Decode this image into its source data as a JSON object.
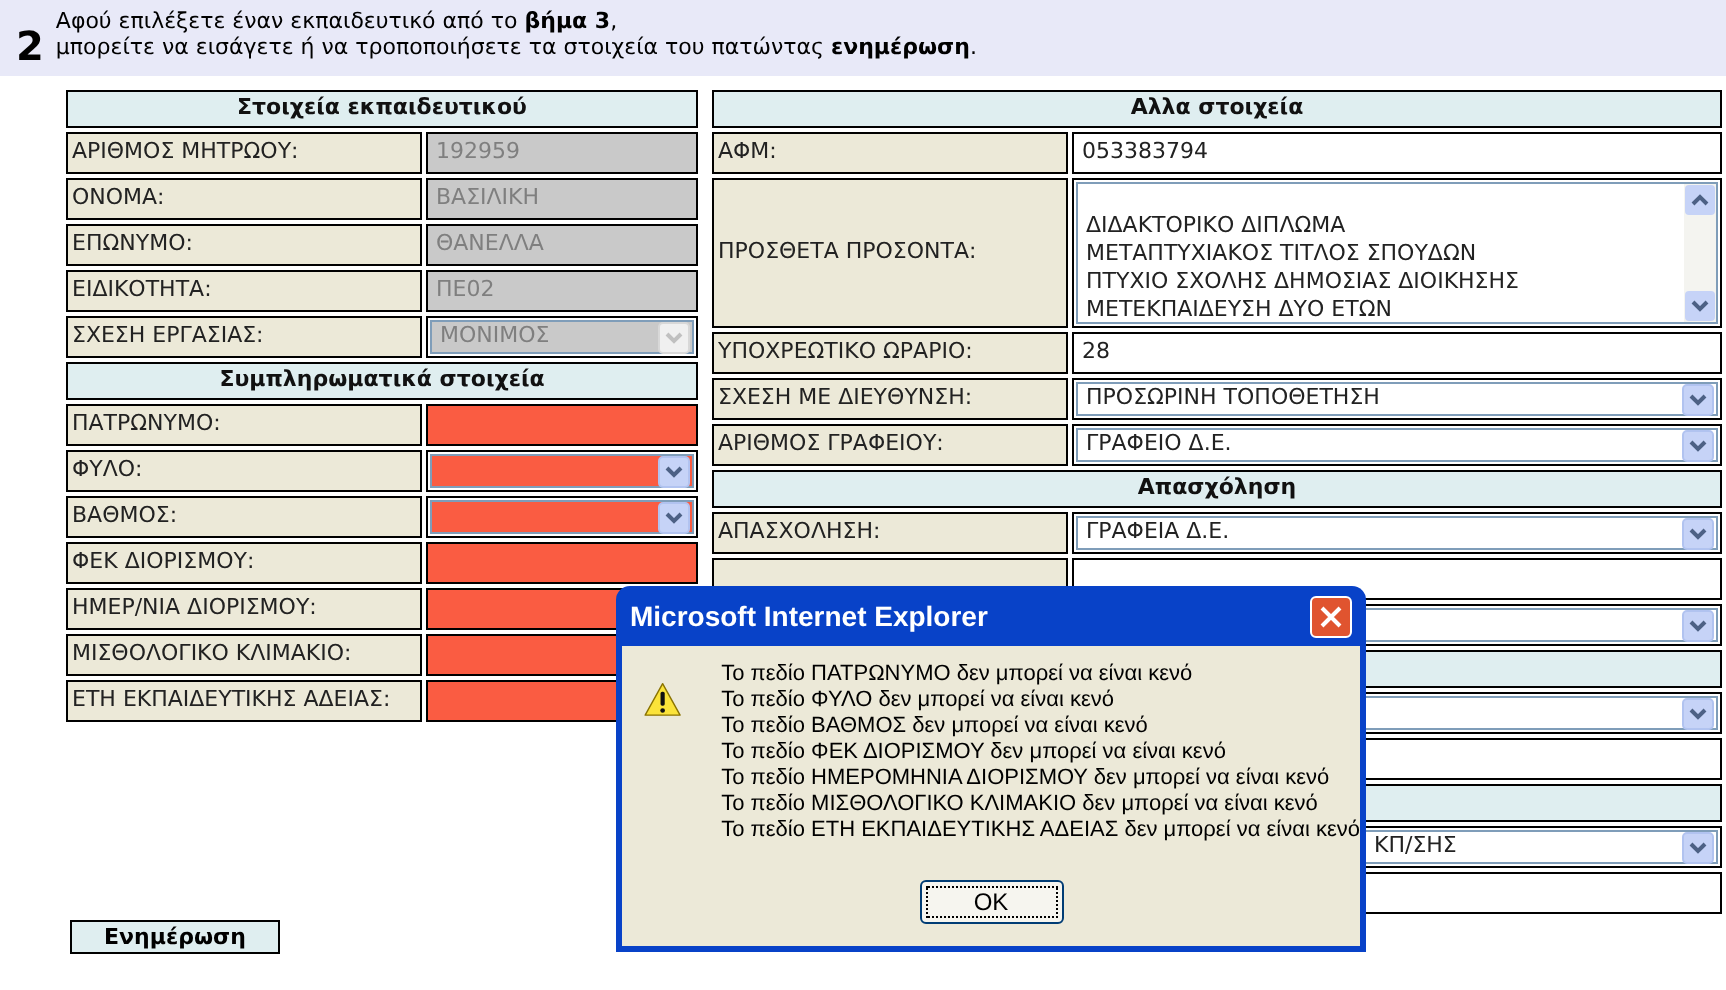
{
  "intro": {
    "step": "2",
    "lines": [
      "Αφού επιλέξετε έναν εκπαιδευτικό από το **βήμα 3**,",
      "μπορείτε να εισάγετε ή να τροποποιήσετε τα στοιχεία του πατώντας **ενημέρωση**."
    ]
  },
  "left_panel": [
    {
      "kind": "header",
      "title": "Στοιχεία εκπαιδευτικού"
    },
    {
      "kind": "input",
      "label": "ΑΡΙΘΜΟΣ ΜΗΤΡΩΟΥ:",
      "value": "192959",
      "disabled": true,
      "invalid": false
    },
    {
      "kind": "input",
      "label": "ΟΝΟΜΑ:",
      "value": "ΒΑΣΙΛΙΚΗ",
      "disabled": true,
      "invalid": false
    },
    {
      "kind": "input",
      "label": "ΕΠΩΝΥΜΟ:",
      "value": "ΘΑΝΕΛΛΑ",
      "disabled": true,
      "invalid": false
    },
    {
      "kind": "input",
      "label": "ΕΙΔΙΚΟΤΗΤΑ:",
      "value": "ΠΕ02",
      "disabled": true,
      "invalid": false
    },
    {
      "kind": "select",
      "label": "ΣΧΕΣΗ ΕΡΓΑΣΙΑΣ:",
      "value": "ΜΟΝΙΜΟΣ",
      "disabled": true,
      "invalid": false
    },
    {
      "kind": "header",
      "title": "Συμπληρωματικά στοιχεία"
    },
    {
      "kind": "input",
      "label": "ΠΑΤΡΩΝΥΜΟ:",
      "disabled": false,
      "invalid": true
    },
    {
      "kind": "select",
      "label": "ΦΥΛΟ:",
      "disabled": false,
      "invalid": true
    },
    {
      "kind": "select",
      "label": "ΒΑΘΜΟΣ:",
      "disabled": false,
      "invalid": true
    },
    {
      "kind": "input",
      "label": "ΦΕΚ ΔΙΟΡΙΣΜΟΥ:",
      "disabled": false,
      "invalid": true
    },
    {
      "kind": "input",
      "label": "ΗΜΕΡ/ΝΙΑ ΔΙΟΡΙΣΜΟΥ:",
      "disabled": false,
      "invalid": true
    },
    {
      "kind": "input",
      "label": "ΜΙΣΘΟΛΟΓΙΚΟ ΚΛΙΜΑΚΙΟ:",
      "disabled": false,
      "invalid": true
    },
    {
      "kind": "input",
      "label": "ΕΤΗ ΕΚΠΑΙΔΕΥΤΙΚΗΣ ΑΔΕΙΑΣ:",
      "disabled": false,
      "invalid": true
    }
  ],
  "right_panel": [
    {
      "kind": "header",
      "title": "Αλλα στοιχεία"
    },
    {
      "kind": "input",
      "label": "ΑΦΜ:",
      "value": "053383794",
      "disabled": false,
      "invalid": false
    },
    {
      "kind": "list",
      "label": "ΠΡΟΣΘΕΤΑ ΠΡΟΣΟΝΤΑ:",
      "items": [
        "ΔΙΔΑΚΤΟΡΙΚΟ ΔΙΠΛΩΜΑ",
        "ΜΕΤΑΠΤΥΧΙΑΚΟΣ ΤΙΤΛΟΣ ΣΠΟΥΔΩΝ",
        "ΠΤΥΧΙΟ ΣΧΟΛΗΣ ΔΗΜΟΣΙΑΣ ΔΙΟΙΚΗΣΗΣ",
        "ΜΕΤΕΚΠΑΙΔΕΥΣΗ ΔΥΟ ΕΤΩΝ"
      ]
    },
    {
      "kind": "input",
      "label": "ΥΠΟΧΡΕΩΤΙΚΟ ΩΡΑΡΙΟ:",
      "value": "28",
      "disabled": false,
      "invalid": false
    },
    {
      "kind": "select",
      "label": "ΣΧΕΣΗ ΜΕ ΔΙΕΥΘΥΝΣΗ:",
      "value": "ΠΡΟΣΩΡΙΝΗ ΤΟΠΟΘΕΤΗΣΗ",
      "disabled": false,
      "invalid": false
    },
    {
      "kind": "select",
      "label": "ΑΡΙΘΜΟΣ ΓΡΑΦΕΙΟΥ:",
      "value": "ΓΡΑΦΕΙΟ Δ.Ε.",
      "disabled": false,
      "invalid": false
    },
    {
      "kind": "header",
      "title": "Απασχόληση"
    },
    {
      "kind": "select",
      "label": "ΑΠΑΣΧΟΛΗΣΗ:",
      "value": "ΓΡΑΦΕΙΑ Δ.Ε.",
      "disabled": false,
      "invalid": false
    },
    {
      "kind": "input",
      "label_cell": true,
      "disabled": false,
      "invalid": false
    },
    {
      "kind": "select",
      "disabled": false,
      "invalid": false
    },
    {
      "kind": "header"
    },
    {
      "kind": "select",
      "disabled": false,
      "invalid": false
    },
    {
      "kind": "input",
      "disabled": false,
      "invalid": false
    },
    {
      "kind": "header"
    },
    {
      "kind": "select",
      "value": "ΚΠ/ΣΗΣ",
      "disabled": false,
      "invalid": false
    },
    {
      "kind": "input",
      "disabled": false,
      "invalid": false
    }
  ],
  "update_button": "Ενημέρωση",
  "dialog": {
    "title": "Microsoft Internet Explorer",
    "messages": [
      "Το πεδίο ΠΑΤΡΩΝΥΜΟ δεν μπορεί να είναι κενό",
      "Το πεδίο ΦΥΛΟ δεν μπορεί να είναι κενό",
      "Το πεδίο ΒΑΘΜΟΣ δεν μπορεί να είναι κενό",
      "Το πεδίο ΦΕΚ ΔΙΟΡΙΣΜΟΥ δεν μπορεί να είναι κενό",
      "Το πεδίο ΗΜΕΡΟΜΗΝΙΑ ΔΙΟΡΙΣΜΟΥ δεν μπορεί να είναι κενό",
      "Το πεδίο ΜΙΣΘΟΛΟΓΙΚΟ ΚΛΙΜΑΚΙΟ δεν μπορεί να είναι κενό",
      "Το πεδίο ΕΤΗ ΕΚΠΑΙΔΕΥΤΙΚΗΣ ΑΔΕΙΑΣ δεν μπορεί να είναι κενό"
    ],
    "ok_button": "OK"
  }
}
